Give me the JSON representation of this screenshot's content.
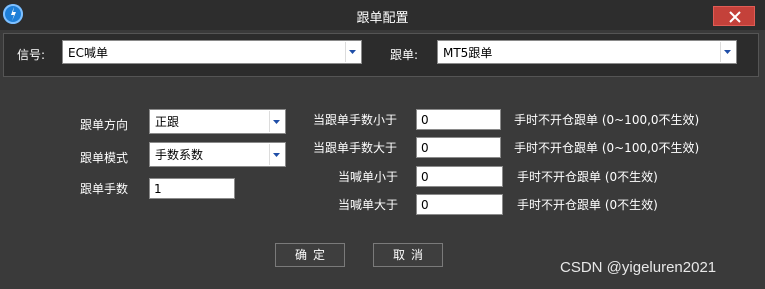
{
  "window": {
    "title": "跟单配置"
  },
  "top": {
    "signal_label": "信号:",
    "signal_value": "EC喊单",
    "follow_label": "跟单:",
    "follow_value": "MT5跟单"
  },
  "settings": {
    "direction_label": "跟单方向",
    "direction_value": "正跟",
    "mode_label": "跟单模式",
    "mode_value": "手数系数",
    "lots_label": "跟单手数",
    "lots_value": "1"
  },
  "conditions": [
    {
      "label": "当跟单手数小于",
      "value": "0",
      "hint": "手时不开仓跟单 (0~100,0不生效)"
    },
    {
      "label": "当跟单手数大于",
      "value": "0",
      "hint": "手时不开仓跟单 (0~100,0不生效)"
    },
    {
      "label": "当喊单小于",
      "value": "0",
      "hint": "手时不开仓跟单 (0不生效)"
    },
    {
      "label": "当喊单大于",
      "value": "0",
      "hint": "手时不开仓跟单 (0不生效)"
    }
  ],
  "buttons": {
    "ok": "确定",
    "cancel": "取消"
  },
  "watermark": "CSDN @yigeluren2021",
  "colors": {
    "background": "#3a3a3a",
    "close": "#c4413a",
    "app_icon": "#1e7fd8"
  }
}
